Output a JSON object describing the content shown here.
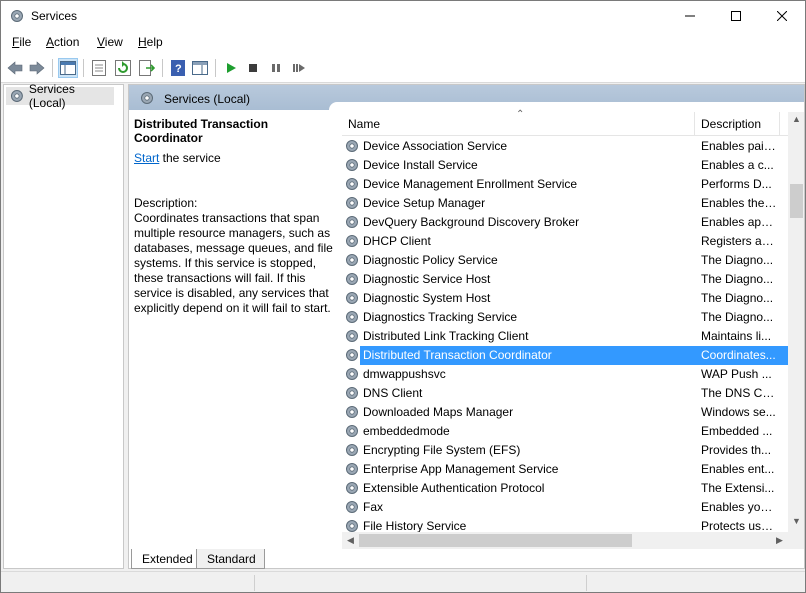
{
  "window": {
    "title": "Services",
    "minimize_icon": "minimize-icon",
    "maximize_icon": "maximize-icon",
    "close_icon": "close-icon"
  },
  "menu": [
    {
      "label": "File",
      "mnemonic": "F",
      "rest": "ile"
    },
    {
      "label": "Action",
      "mnemonic": "A",
      "rest": "ction"
    },
    {
      "label": "View",
      "mnemonic": "V",
      "rest": "iew"
    },
    {
      "label": "Help",
      "mnemonic": "H",
      "rest": "elp"
    }
  ],
  "toolbar": {
    "buttons": [
      "back-icon",
      "forward-icon",
      "show-hide-console-tree-icon",
      "properties-icon",
      "refresh-icon",
      "export-list-icon",
      "help-icon",
      "show-hide-action-pane-icon",
      "start-service-icon",
      "stop-service-icon",
      "pause-service-icon",
      "restart-service-icon"
    ]
  },
  "tree": {
    "root_label": "Services (Local)"
  },
  "pane": {
    "header": "Services (Local)"
  },
  "details": {
    "service_title": "Distributed Transaction Coordinator",
    "start_link": "Start",
    "start_suffix": " the service",
    "description_label": "Description:",
    "description": "Coordinates transactions that span multiple resource managers, such as databases, message queues, and file systems. If this service is stopped, these transactions will fail. If this service is disabled, any services that explicitly depend on it will fail to start."
  },
  "list": {
    "columns": {
      "name": "Name",
      "description": "Description"
    },
    "rows": [
      {
        "name": "Device Association Service",
        "desc": "Enables pair..."
      },
      {
        "name": "Device Install Service",
        "desc": "Enables a c..."
      },
      {
        "name": "Device Management Enrollment Service",
        "desc": "Performs D..."
      },
      {
        "name": "Device Setup Manager",
        "desc": "Enables the ..."
      },
      {
        "name": "DevQuery Background Discovery Broker",
        "desc": "Enables app..."
      },
      {
        "name": "DHCP Client",
        "desc": "Registers an..."
      },
      {
        "name": "Diagnostic Policy Service",
        "desc": "The Diagno..."
      },
      {
        "name": "Diagnostic Service Host",
        "desc": "The Diagno..."
      },
      {
        "name": "Diagnostic System Host",
        "desc": "The Diagno..."
      },
      {
        "name": "Diagnostics Tracking Service",
        "desc": "The Diagno..."
      },
      {
        "name": "Distributed Link Tracking Client",
        "desc": "Maintains li..."
      },
      {
        "name": "Distributed Transaction Coordinator",
        "desc": "Coordinates...",
        "selected": true
      },
      {
        "name": "dmwappushsvc",
        "desc": "WAP Push ..."
      },
      {
        "name": "DNS Client",
        "desc": "The DNS Cli..."
      },
      {
        "name": "Downloaded Maps Manager",
        "desc": "Windows se..."
      },
      {
        "name": "embeddedmode",
        "desc": "Embedded ..."
      },
      {
        "name": "Encrypting File System (EFS)",
        "desc": "Provides th..."
      },
      {
        "name": "Enterprise App Management Service",
        "desc": "Enables ent..."
      },
      {
        "name": "Extensible Authentication Protocol",
        "desc": "The Extensi..."
      },
      {
        "name": "Fax",
        "desc": "Enables you..."
      },
      {
        "name": "File History Service",
        "desc": "Protects use..."
      }
    ]
  },
  "tabs": {
    "extended": "Extended",
    "standard": "Standard"
  },
  "colors": {
    "selection": "#3399ff",
    "link": "#0066cc",
    "pane_header": "#b8c9dc"
  }
}
